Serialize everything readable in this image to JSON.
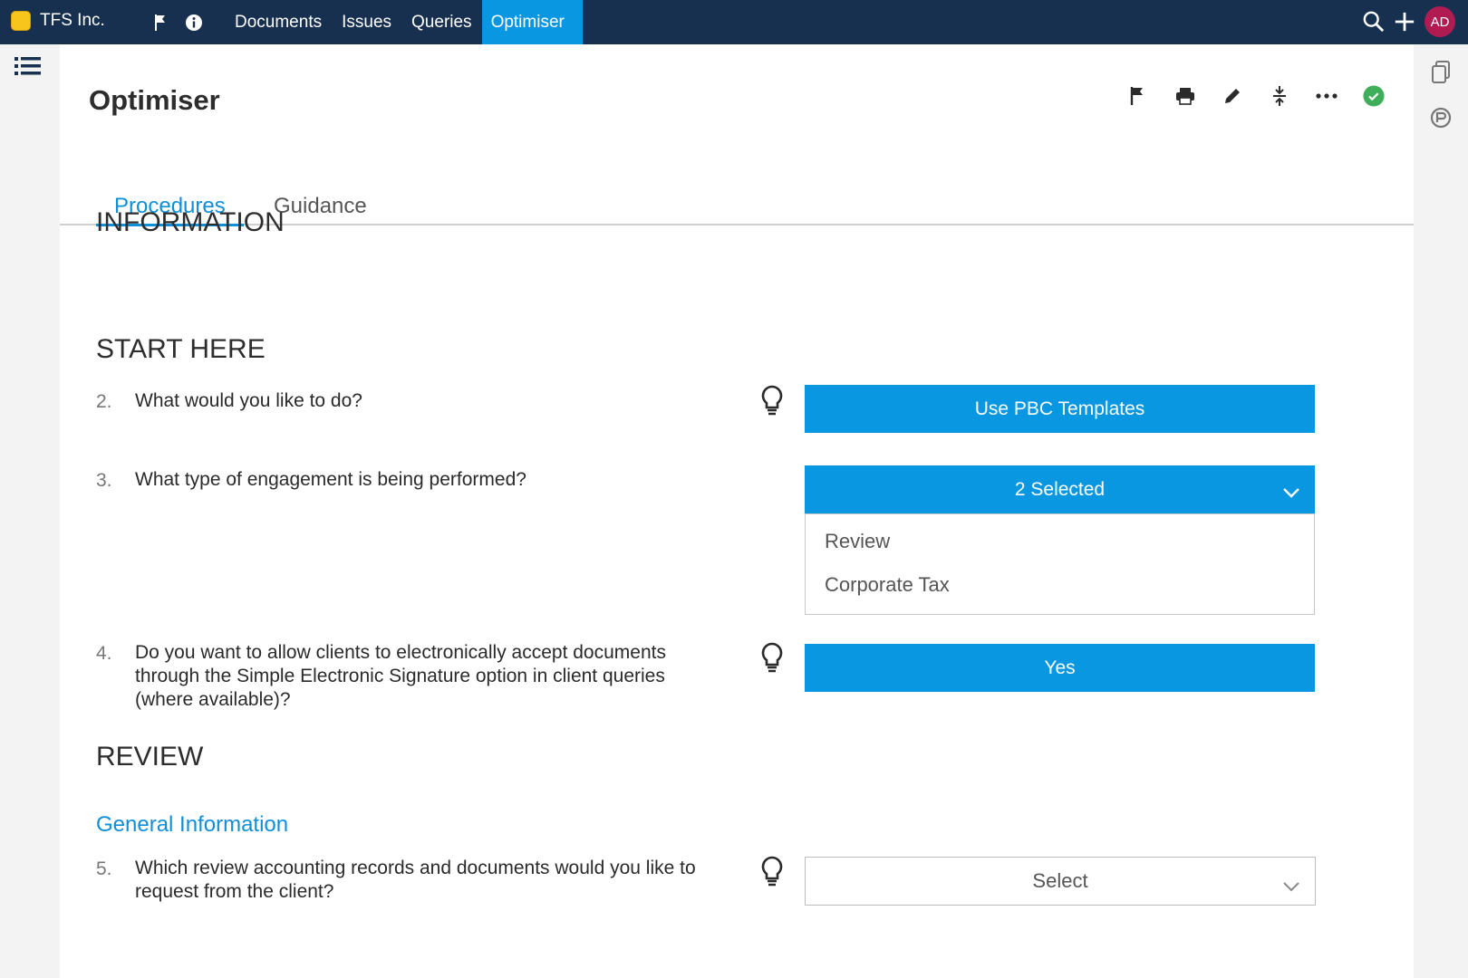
{
  "app": {
    "company": "TFS Inc.",
    "nav": [
      "Documents",
      "Issues",
      "Queries",
      "Optimiser"
    ],
    "active_nav": "Optimiser",
    "avatar_initials": "AD"
  },
  "page": {
    "title": "Optimiser",
    "tabs": [
      "Procedures",
      "Guidance"
    ],
    "active_tab": "Procedures"
  },
  "sections": {
    "information": "INFORMATION",
    "start_here": "START HERE",
    "review": "REVIEW",
    "general_information": "General Information"
  },
  "questions": [
    {
      "num": "2.",
      "text": "What would you like to do?",
      "answer": "Use PBC Templates"
    },
    {
      "num": "3.",
      "text": "What type of engagement is being performed?",
      "answer": "2 Selected",
      "options": [
        "Review",
        "Corporate Tax"
      ]
    },
    {
      "num": "4.",
      "text": "Do you want to allow clients to electronically accept documents through the Simple Electronic Signature option in client queries (where available)?",
      "answer": "Yes"
    },
    {
      "num": "5.",
      "text": "Which review accounting records and documents would you like to request from the client?",
      "answer": "Select"
    }
  ],
  "colors": {
    "topbar": "#18304f",
    "accent": "#0897e0",
    "link": "#0f8fd8",
    "avatar": "#b01b52",
    "status_ok": "#3fae5a"
  }
}
